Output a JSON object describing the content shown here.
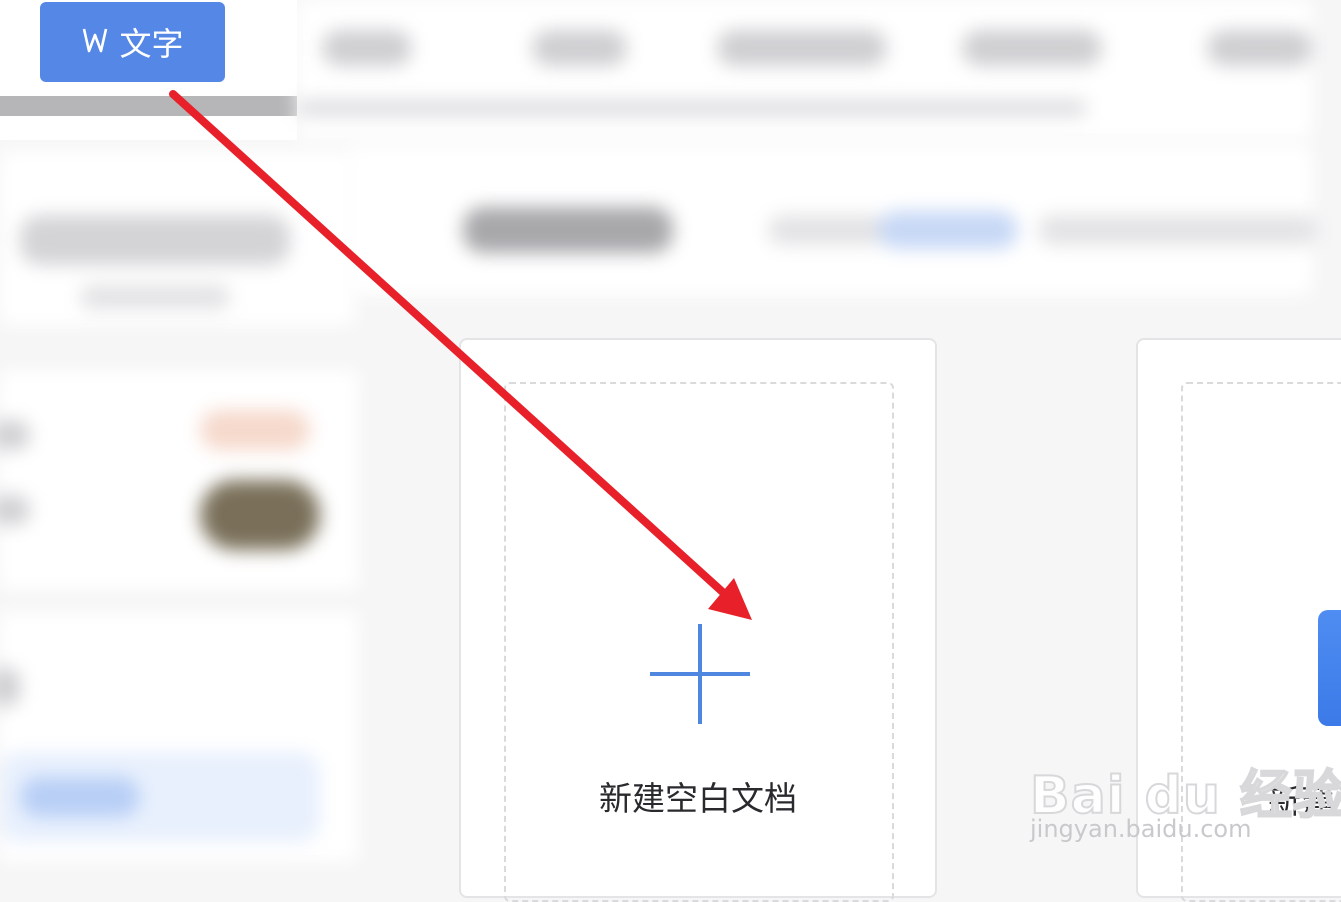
{
  "tab": {
    "label": "文字",
    "icon": "word-w-icon",
    "color": "#5588e6"
  },
  "cards": [
    {
      "label": "新建空白文档",
      "icon": "plus-icon"
    },
    {
      "label": "新建"
    }
  ],
  "watermark": {
    "brand": "Bai du 经验",
    "url": "jingyan.baidu.com"
  },
  "annotation": {
    "type": "arrow",
    "color": "#e8202a"
  }
}
